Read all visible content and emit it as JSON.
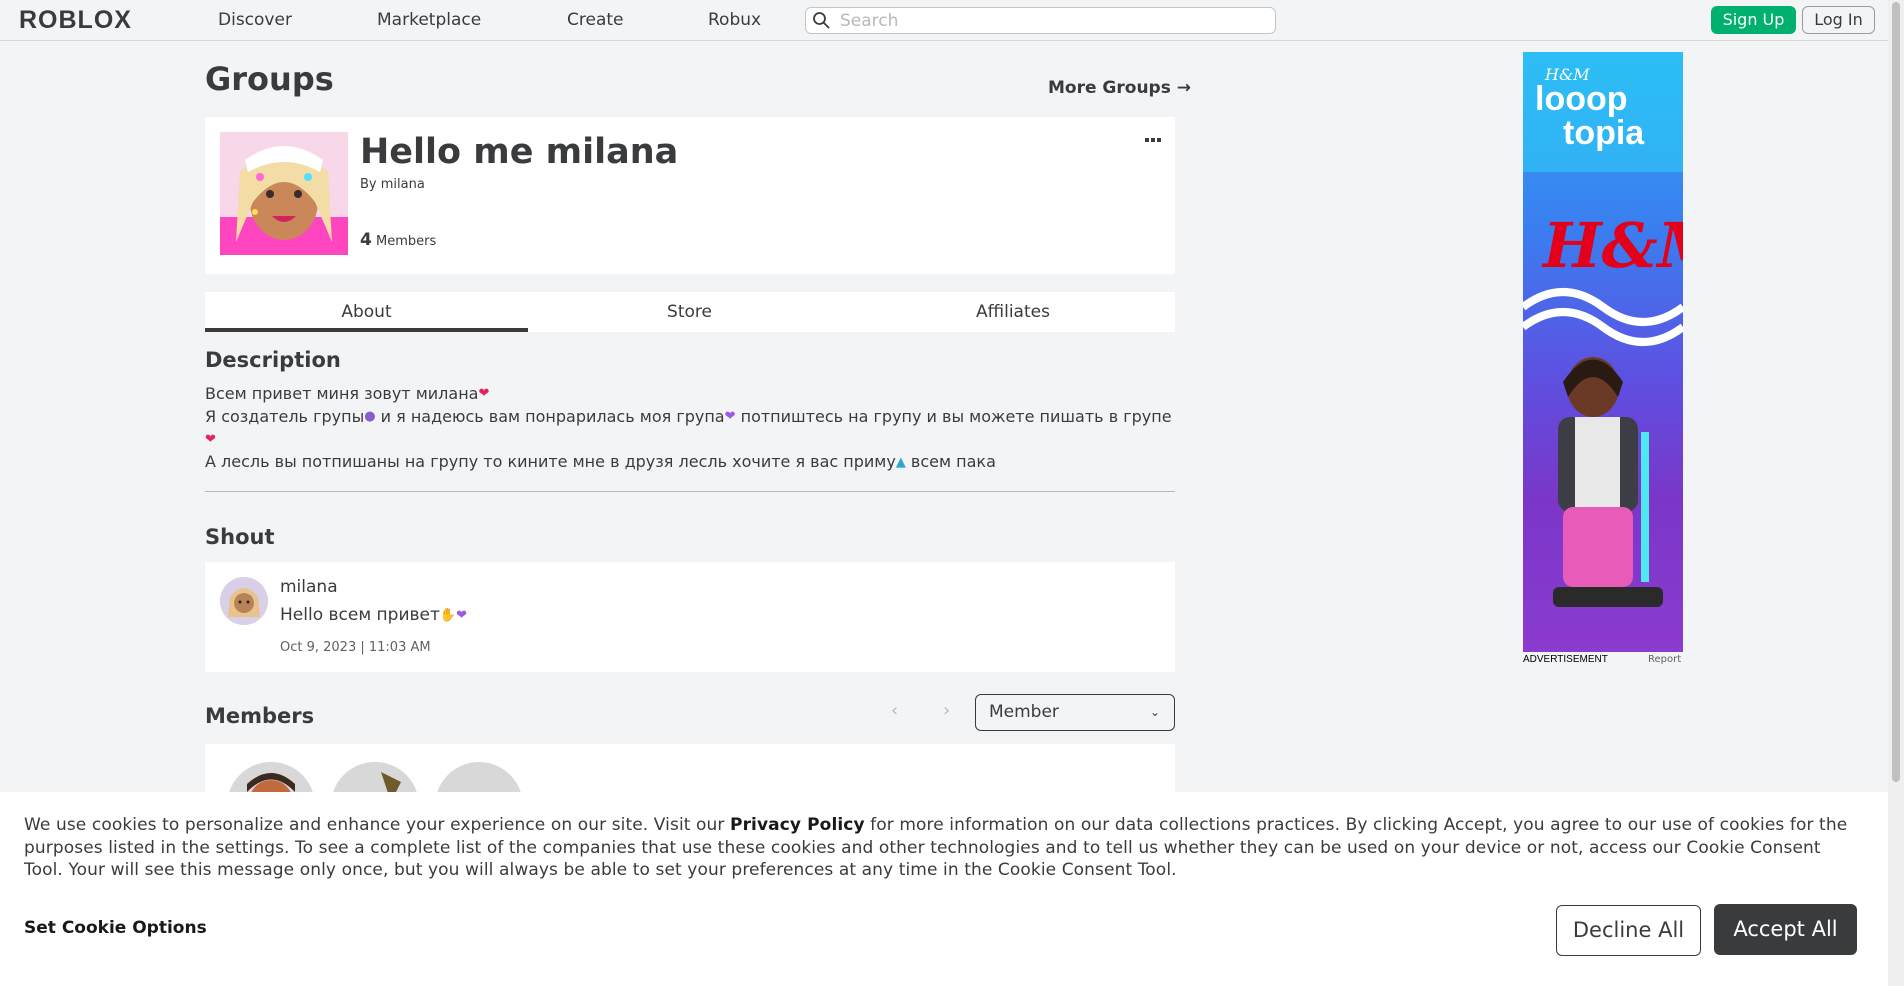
{
  "nav": {
    "logo": "ROBLOX",
    "links": [
      "Discover",
      "Marketplace",
      "Create",
      "Robux"
    ],
    "search_placeholder": "Search",
    "signup": "Sign Up",
    "login": "Log In"
  },
  "page": {
    "title": "Groups",
    "more_groups": "More Groups →"
  },
  "group": {
    "name": "Hello me milana",
    "by_prefix": "By",
    "owner": "milana",
    "member_count": "4",
    "member_label": "Members",
    "more_icon": "ellipsis-icon"
  },
  "tabs": [
    {
      "label": "About",
      "active": true
    },
    {
      "label": "Store",
      "active": false
    },
    {
      "label": "Affiliates",
      "active": false
    }
  ],
  "description": {
    "heading": "Description",
    "line1": "Всем привет миня зовут милана",
    "line2a": "Я создатель групы",
    "line2b": " и я надеюсь вам понрарилась моя група",
    "line2c": " потпиштесь на групу и вы можете пишать в групе",
    "line3a": "А лесль вы потпишаны на групу то кините мне в друзя лесль хочите я вас приму",
    "line3b": " всем пака"
  },
  "shout": {
    "heading": "Shout",
    "user": "milana",
    "message": "Hello всем привет",
    "date": "Oct 9, 2023 | 11:03 AM"
  },
  "members": {
    "heading": "Members",
    "role_selected": "Member",
    "prev_icon": "chevron-left-icon",
    "next_icon": "chevron-right-icon"
  },
  "ad": {
    "label": "ADVERTISEMENT",
    "report": "Report",
    "brand_small": "H&M",
    "brand_line1": "looop",
    "brand_line2": "topia",
    "brand_big": "H&M"
  },
  "cookie": {
    "text_before": "We use cookies to personalize and enhance your experience on our site. Visit our ",
    "link": "Privacy Policy",
    "text_after": " for more information on our data collections practices. By clicking Accept, you agree to our use of cookies for the purposes listed in the settings. To see a complete list of the companies that use these cookies and other technologies and to tell us whether they can be used on your device or not, access our Cookie Consent Tool. Your will see this message only once, but you will always be able to set your preferences at any time in the Cookie Consent Tool.",
    "options": "Set Cookie Options",
    "decline": "Decline All",
    "accept": "Accept All"
  },
  "colors": {
    "accent_green": "#00b06f",
    "text": "#393b3d",
    "background": "#f2f4f5"
  }
}
